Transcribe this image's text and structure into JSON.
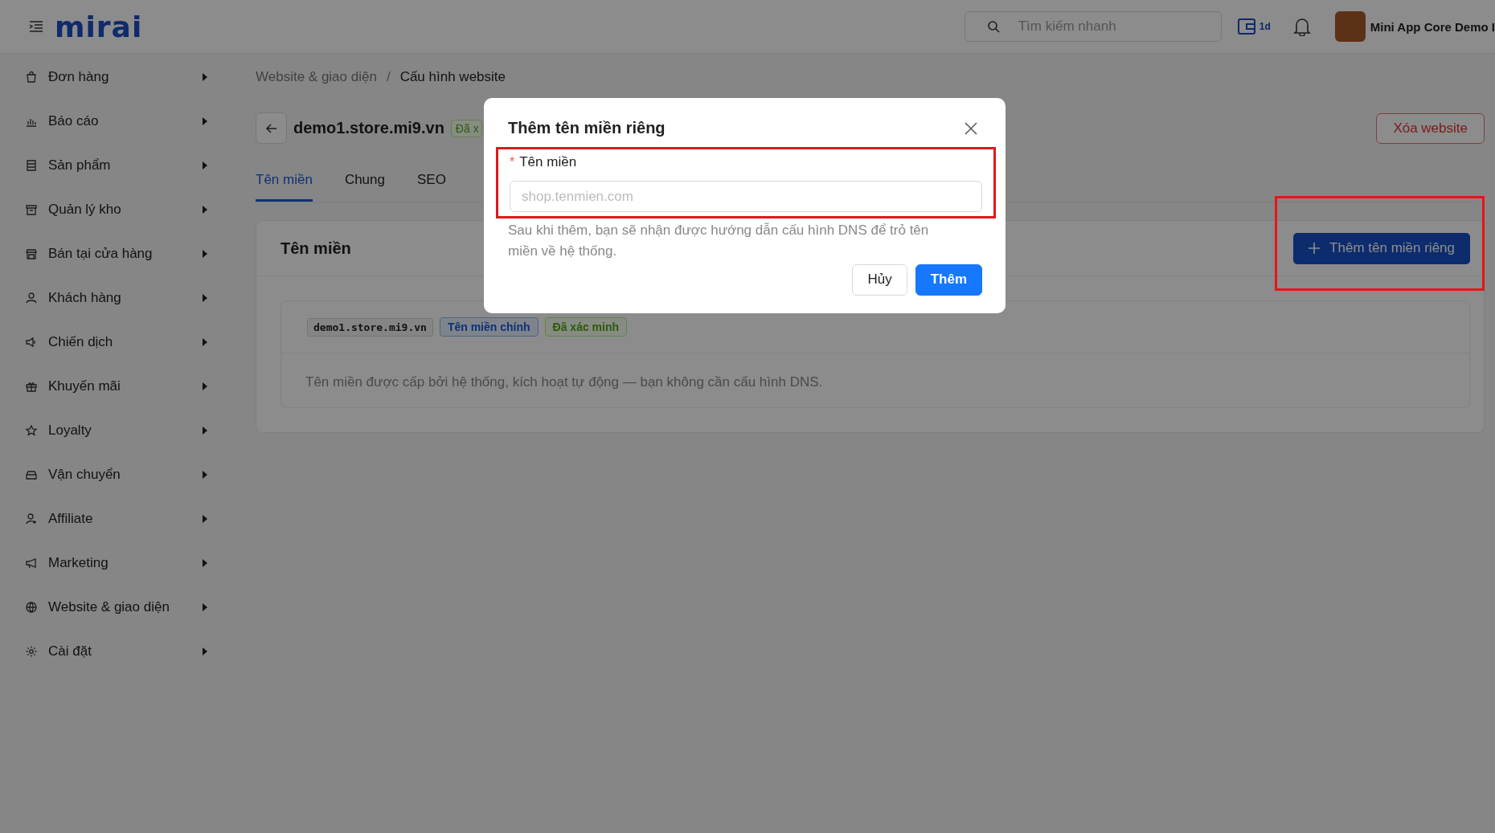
{
  "header": {
    "logo_text": "mirai",
    "search": {
      "placeholder": "Tìm kiếm nhanh"
    },
    "wallet_text": "1d",
    "user_name": "Mini App Core Demo I"
  },
  "sidebar": {
    "items": [
      {
        "label": "Đơn hàng"
      },
      {
        "label": "Báo cáo"
      },
      {
        "label": "Sản phẩm"
      },
      {
        "label": "Quản lý kho"
      },
      {
        "label": "Bán tại cửa hàng"
      },
      {
        "label": "Khách hàng"
      },
      {
        "label": "Chiến dịch"
      },
      {
        "label": "Khuyến mãi"
      },
      {
        "label": "Loyalty"
      },
      {
        "label": "Vận chuyển"
      },
      {
        "label": "Affiliate"
      },
      {
        "label": "Marketing"
      },
      {
        "label": "Website & giao diện"
      },
      {
        "label": "Cài đặt"
      }
    ]
  },
  "breadcrumb": {
    "separator": "/",
    "items": [
      {
        "label": "Website & giao diện",
        "current": false
      },
      {
        "label": "Cấu hình website",
        "current": true
      }
    ]
  },
  "page_header": {
    "title": "demo1.store.mi9.vn",
    "status_badge": "Đã x",
    "delete_button": "Xóa website"
  },
  "tabs": [
    {
      "label": "Tên miền",
      "selected": true
    },
    {
      "label": "Chung",
      "selected": false
    },
    {
      "label": "SEO",
      "selected": false
    }
  ],
  "domain_card": {
    "title": "Tên miền",
    "add_button": {
      "label": "Thêm tên miền riêng",
      "highlighted": true
    },
    "domains": [
      {
        "name": "demo1.store.mi9.vn",
        "tags": [
          {
            "label": "Tên miền chính",
            "kind": "primary"
          },
          {
            "label": "Đã xác minh",
            "kind": "verified"
          }
        ],
        "description": "Tên miền được cấp bởi hệ thống, kích hoạt tự động — bạn không cần cấu hình DNS."
      }
    ]
  },
  "modal": {
    "title": "Thêm tên miền riêng",
    "field": {
      "label": "Tên miền",
      "required_mark": "*",
      "placeholder": "shop.tenmien.com",
      "highlighted": true
    },
    "help": "Sau khi thêm, bạn sẽ nhận được hướng dẫn cấu hình DNS để trỏ tên miền về hệ thống.",
    "buttons": [
      {
        "label": "Hủy",
        "kind": "default"
      },
      {
        "label": "Thêm",
        "kind": "primary"
      }
    ]
  }
}
